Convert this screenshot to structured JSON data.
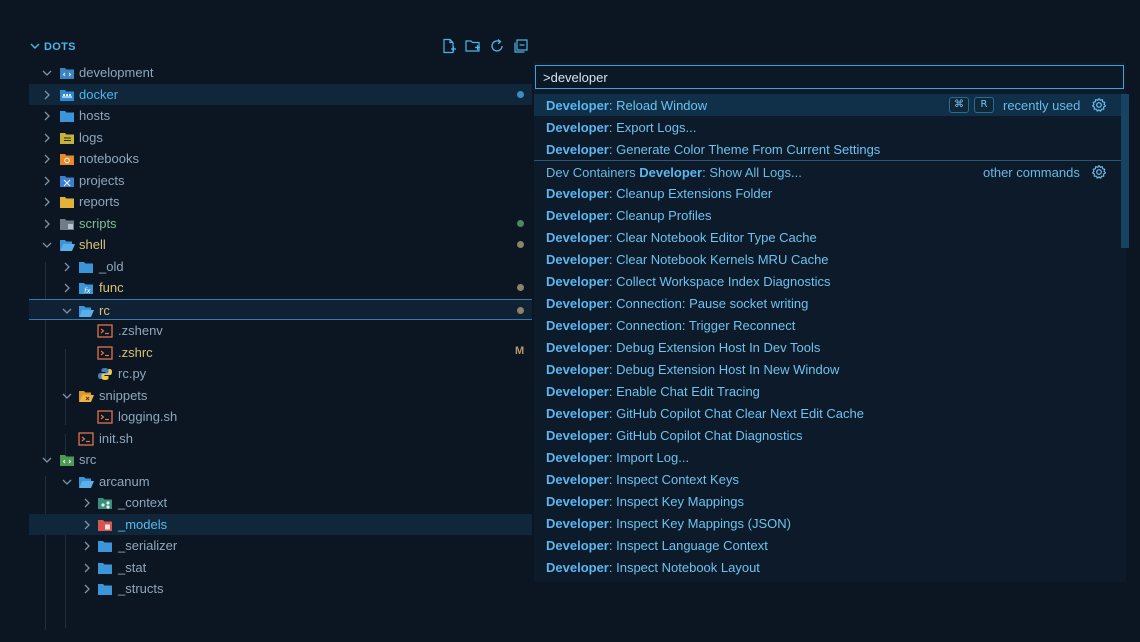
{
  "explorer": {
    "title": "DOTS",
    "rows": [
      {
        "label": "development"
      },
      {
        "label": "docker"
      },
      {
        "label": "hosts"
      },
      {
        "label": "logs"
      },
      {
        "label": "notebooks"
      },
      {
        "label": "projects"
      },
      {
        "label": "reports"
      },
      {
        "label": "scripts"
      },
      {
        "label": "shell"
      },
      {
        "label": "_old"
      },
      {
        "label": "func"
      },
      {
        "label": "rc"
      },
      {
        "label": ".zshenv"
      },
      {
        "label": ".zshrc",
        "badge": "M"
      },
      {
        "label": "rc.py"
      },
      {
        "label": "snippets"
      },
      {
        "label": "logging.sh"
      },
      {
        "label": "init.sh"
      },
      {
        "label": "src"
      },
      {
        "label": "arcanum"
      },
      {
        "label": "_context"
      },
      {
        "label": "_models"
      },
      {
        "label": "_serializer"
      },
      {
        "label": "_stat"
      },
      {
        "label": "_structs"
      }
    ]
  },
  "palette": {
    "query": ">developer",
    "items": [
      {
        "prefix": "",
        "bold": "Developer",
        "rest": ": Reload Window",
        "keys": [
          "⌘",
          "R"
        ],
        "tag": "recently used"
      },
      {
        "prefix": "",
        "bold": "Developer",
        "rest": ": Export Logs..."
      },
      {
        "prefix": "",
        "bold": "Developer",
        "rest": ": Generate Color Theme From Current Settings"
      },
      {
        "prefix": "Dev Containers ",
        "bold": "Developer",
        "rest": ": Show All Logs...",
        "tag": "other commands"
      },
      {
        "prefix": "",
        "bold": "Developer",
        "rest": ": Cleanup Extensions Folder"
      },
      {
        "prefix": "",
        "bold": "Developer",
        "rest": ": Cleanup Profiles"
      },
      {
        "prefix": "",
        "bold": "Developer",
        "rest": ": Clear Notebook Editor Type Cache"
      },
      {
        "prefix": "",
        "bold": "Developer",
        "rest": ": Clear Notebook Kernels MRU Cache"
      },
      {
        "prefix": "",
        "bold": "Developer",
        "rest": ": Collect Workspace Index Diagnostics"
      },
      {
        "prefix": "",
        "bold": "Developer",
        "rest": ": Connection: Pause socket writing"
      },
      {
        "prefix": "",
        "bold": "Developer",
        "rest": ": Connection: Trigger Reconnect"
      },
      {
        "prefix": "",
        "bold": "Developer",
        "rest": ": Debug Extension Host In Dev Tools"
      },
      {
        "prefix": "",
        "bold": "Developer",
        "rest": ": Debug Extension Host In New Window"
      },
      {
        "prefix": "",
        "bold": "Developer",
        "rest": ": Enable Chat Edit Tracing"
      },
      {
        "prefix": "",
        "bold": "Developer",
        "rest": ": GitHub Copilot Chat Clear Next Edit Cache"
      },
      {
        "prefix": "",
        "bold": "Developer",
        "rest": ": GitHub Copilot Chat Diagnostics"
      },
      {
        "prefix": "",
        "bold": "Developer",
        "rest": ": Import Log..."
      },
      {
        "prefix": "",
        "bold": "Developer",
        "rest": ": Inspect Context Keys"
      },
      {
        "prefix": "",
        "bold": "Developer",
        "rest": ": Inspect Key Mappings"
      },
      {
        "prefix": "",
        "bold": "Developer",
        "rest": ": Inspect Key Mappings (JSON)"
      },
      {
        "prefix": "",
        "bold": "Developer",
        "rest": ": Inspect Language Context"
      },
      {
        "prefix": "",
        "bold": "Developer",
        "rest": ": Inspect Notebook Layout"
      }
    ]
  },
  "colors": {
    "background": "#0b1622",
    "accent": "#4fb4e8",
    "input_border": "#3aa2dc",
    "modified": "#b8986c"
  }
}
